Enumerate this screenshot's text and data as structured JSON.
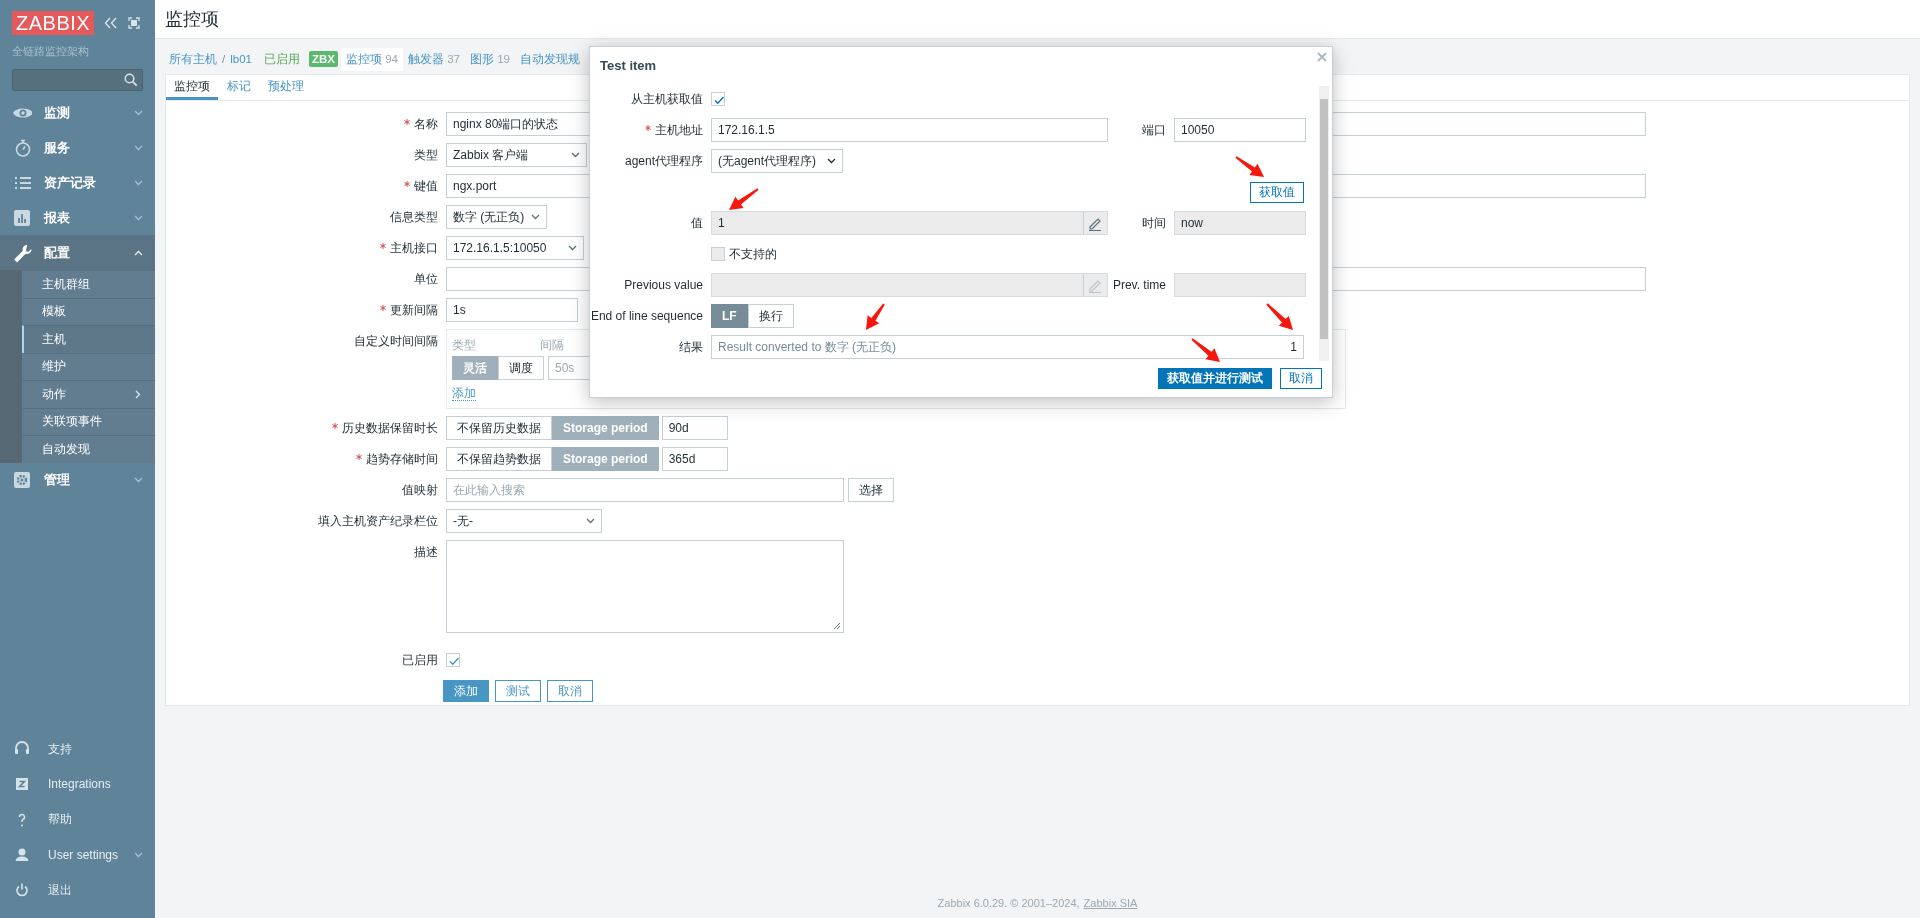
{
  "sidebar": {
    "logo": "ZABBIX",
    "subtitle": "全链路监控架构",
    "menu": [
      {
        "label": "监测",
        "expanded": false
      },
      {
        "label": "服务",
        "expanded": false
      },
      {
        "label": "资产记录",
        "expanded": false
      },
      {
        "label": "报表",
        "expanded": false
      },
      {
        "label": "配置",
        "expanded": true,
        "children": [
          {
            "label": "主机群组",
            "selected": false,
            "kind": "link"
          },
          {
            "label": "模板",
            "selected": false,
            "kind": "link"
          },
          {
            "label": "主机",
            "selected": true,
            "kind": "link"
          },
          {
            "label": "维护",
            "selected": false,
            "kind": "link"
          },
          {
            "label": "动作",
            "selected": false,
            "kind": "submenu"
          },
          {
            "label": "关联项事件",
            "selected": false,
            "kind": "link"
          },
          {
            "label": "自动发现",
            "selected": false,
            "kind": "link"
          }
        ]
      },
      {
        "label": "管理",
        "expanded": false
      }
    ],
    "bottom_menu": [
      {
        "label": "支持",
        "kind": "link"
      },
      {
        "label": "Integrations",
        "kind": "link"
      },
      {
        "label": "帮助",
        "kind": "link"
      },
      {
        "label": "User settings",
        "kind": "menu"
      },
      {
        "label": "退出",
        "kind": "link"
      }
    ]
  },
  "page_title": "监控项",
  "breadcrumbs": [
    {
      "label": "所有主机"
    },
    {
      "label": "lb01"
    }
  ],
  "breadcrumb_separator": "/",
  "host_nav": [
    {
      "kind": "status",
      "label": "已启用"
    },
    {
      "kind": "badge",
      "label": "ZBX"
    },
    {
      "kind": "link",
      "label": "监控项",
      "count": "94",
      "selected": true
    },
    {
      "kind": "link",
      "label": "触发器",
      "count": "37",
      "selected": false
    },
    {
      "kind": "link",
      "label": "图形",
      "count": "19",
      "selected": false
    },
    {
      "kind": "link",
      "label": "自动发现规",
      "selected": false
    }
  ],
  "form_tabs": [
    {
      "label": "监控项",
      "selected": true
    },
    {
      "label": "标记",
      "selected": false
    },
    {
      "label": "预处理",
      "selected": false
    }
  ],
  "fields": [
    {
      "kind": "text",
      "label": "名称",
      "required": true,
      "value": "nginx 80端口的状态"
    },
    {
      "kind": "select",
      "label": "类型",
      "required": false,
      "value": "Zabbix 客户端"
    },
    {
      "kind": "text",
      "label": "键值",
      "required": true,
      "value": "ngx.port"
    },
    {
      "kind": "select",
      "label": "信息类型",
      "required": false,
      "value": "数字 (无正负)"
    },
    {
      "kind": "select",
      "label": "主机接口",
      "required": true,
      "value": "172.16.1.5:10050"
    },
    {
      "kind": "text",
      "label": "单位",
      "required": false
    },
    {
      "kind": "text",
      "label": "更新间隔",
      "required": true,
      "value": "1s"
    },
    {
      "kind": "intervals",
      "label": "自定义时间间隔",
      "required": false,
      "columns": [
        "类型",
        "间隔"
      ],
      "options": [
        {
          "label": "灵活",
          "selected": true
        },
        {
          "label": "调度",
          "selected": false
        }
      ],
      "placeholder": "50s",
      "add_link": "添加"
    },
    {
      "kind": "storage",
      "label": "历史数据保留时长",
      "required": true,
      "options": [
        {
          "label": "不保留历史数据",
          "selected": false
        },
        {
          "label": "Storage period",
          "selected": true
        }
      ],
      "value": "90d"
    },
    {
      "kind": "storage",
      "label": "趋势存储时间",
      "required": true,
      "options": [
        {
          "label": "不保留趋势数据",
          "selected": false
        },
        {
          "label": "Storage period",
          "selected": true
        }
      ],
      "value": "365d"
    },
    {
      "kind": "search",
      "label": "值映射",
      "required": false,
      "placeholder": "在此输入搜索",
      "button": "选择"
    },
    {
      "kind": "select",
      "label": "填入主机资产纪录栏位",
      "required": false,
      "value": "-无-"
    },
    {
      "kind": "textarea",
      "label": "描述",
      "required": false
    },
    {
      "kind": "checkbox",
      "label": "已启用",
      "required": false,
      "checked": true
    }
  ],
  "form_buttons": [
    {
      "label": "添加",
      "primary": true
    },
    {
      "label": "测试",
      "primary": false
    },
    {
      "label": "取消",
      "primary": false
    }
  ],
  "dialog": {
    "title": "Test item",
    "get_from_host": {
      "label": "从主机获取值",
      "checked": true
    },
    "host_address": {
      "label": "主机地址",
      "required": true,
      "value": "172.16.1.5"
    },
    "port": {
      "label": "端口",
      "value": "10050"
    },
    "proxy": {
      "label": "agent代理程序",
      "value": "(无agent代理程序)"
    },
    "get_value_button": "获取值",
    "value": {
      "label": "值",
      "value": "1"
    },
    "time": {
      "label": "时间",
      "value": "now"
    },
    "not_supported": {
      "label": "不支持的",
      "checked": false
    },
    "previous_value": {
      "label": "Previous value"
    },
    "prev_time": {
      "label": "Prev. time"
    },
    "eol": {
      "label": "End of line sequence",
      "options": [
        {
          "label": "LF",
          "selected": true
        },
        {
          "label": "换行",
          "selected": false
        }
      ]
    },
    "result": {
      "label": "结果",
      "text": "Result converted to 数字 (无正负)",
      "value": "1"
    },
    "buttons": [
      {
        "label": "获取值并进行测试",
        "primary": true
      },
      {
        "label": "取消",
        "primary": false
      }
    ]
  },
  "footer": {
    "text": "Zabbix 6.0.29. © 2001–2024,",
    "link": "Zabbix SIA"
  }
}
